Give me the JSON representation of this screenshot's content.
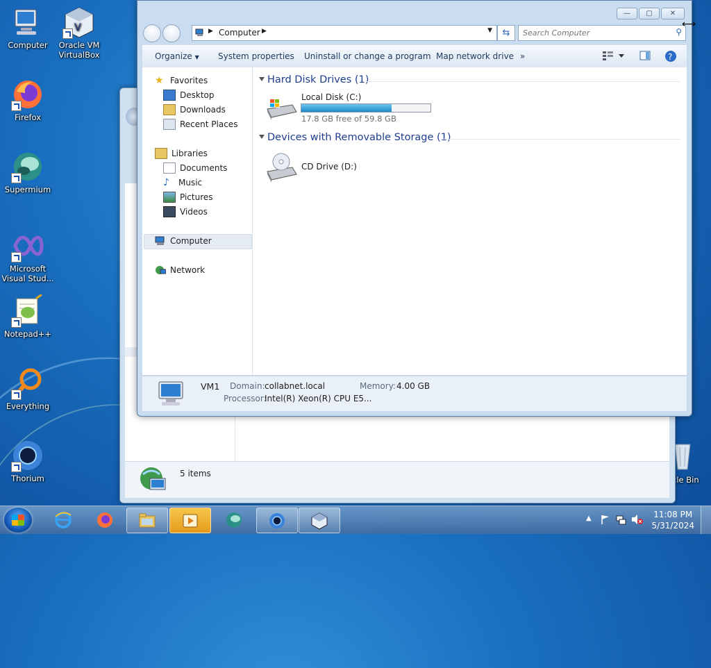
{
  "desktop": {
    "icons": [
      {
        "label": "Computer"
      },
      {
        "label": "Oracle VM\nVirtualBox"
      },
      {
        "label": "Firefox"
      },
      {
        "label": "Supermium"
      },
      {
        "label": "Microsoft\nVisual Stud..."
      },
      {
        "label": "Notepad++"
      },
      {
        "label": "Everything"
      },
      {
        "label": "Thorium"
      },
      {
        "label": "cle Bin"
      }
    ]
  },
  "background_window": {
    "status_text": "5 items"
  },
  "explorer": {
    "caption_buttons": {
      "minimize": "—",
      "maximize": "▢",
      "close": "✕"
    },
    "address": {
      "root_icon": "computer-icon",
      "path": "Computer"
    },
    "search": {
      "placeholder": "Search Computer"
    },
    "toolbar": {
      "organize": "Organize",
      "system_properties": "System properties",
      "uninstall": "Uninstall or change a program",
      "map_drive": "Map network drive",
      "more": "»"
    },
    "nav": {
      "favorites": "Favorites",
      "favorites_items": [
        "Desktop",
        "Downloads",
        "Recent Places"
      ],
      "libraries": "Libraries",
      "libraries_items": [
        "Documents",
        "Music",
        "Pictures",
        "Videos"
      ],
      "computer": "Computer",
      "network": "Network"
    },
    "groups": {
      "hdd": {
        "title": "Hard Disk Drives (1)",
        "drive": {
          "name": "Local Disk (C:)",
          "free_text": "17.8 GB free of 59.8 GB",
          "used_fraction": 0.7
        }
      },
      "removable": {
        "title": "Devices with Removable Storage (1)",
        "drive": {
          "name": "CD Drive (D:)"
        }
      }
    },
    "details": {
      "name": "VM1",
      "domain_label": "Domain:",
      "domain": "collabnet.local",
      "memory_label": "Memory:",
      "memory": "4.00 GB",
      "processor_label": "Processor:",
      "processor": "Intel(R) Xeon(R) CPU E5..."
    }
  },
  "taskbar": {
    "apps": [
      "Internet Explorer",
      "Firefox",
      "Windows Explorer",
      "Media",
      "Supermium",
      "Thorium",
      "VirtualBox"
    ],
    "clock": {
      "time": "11:08 PM",
      "date": "5/31/2024"
    }
  },
  "colors": {
    "accent": "#1e3d8f",
    "progress": "#2a9fd8"
  }
}
